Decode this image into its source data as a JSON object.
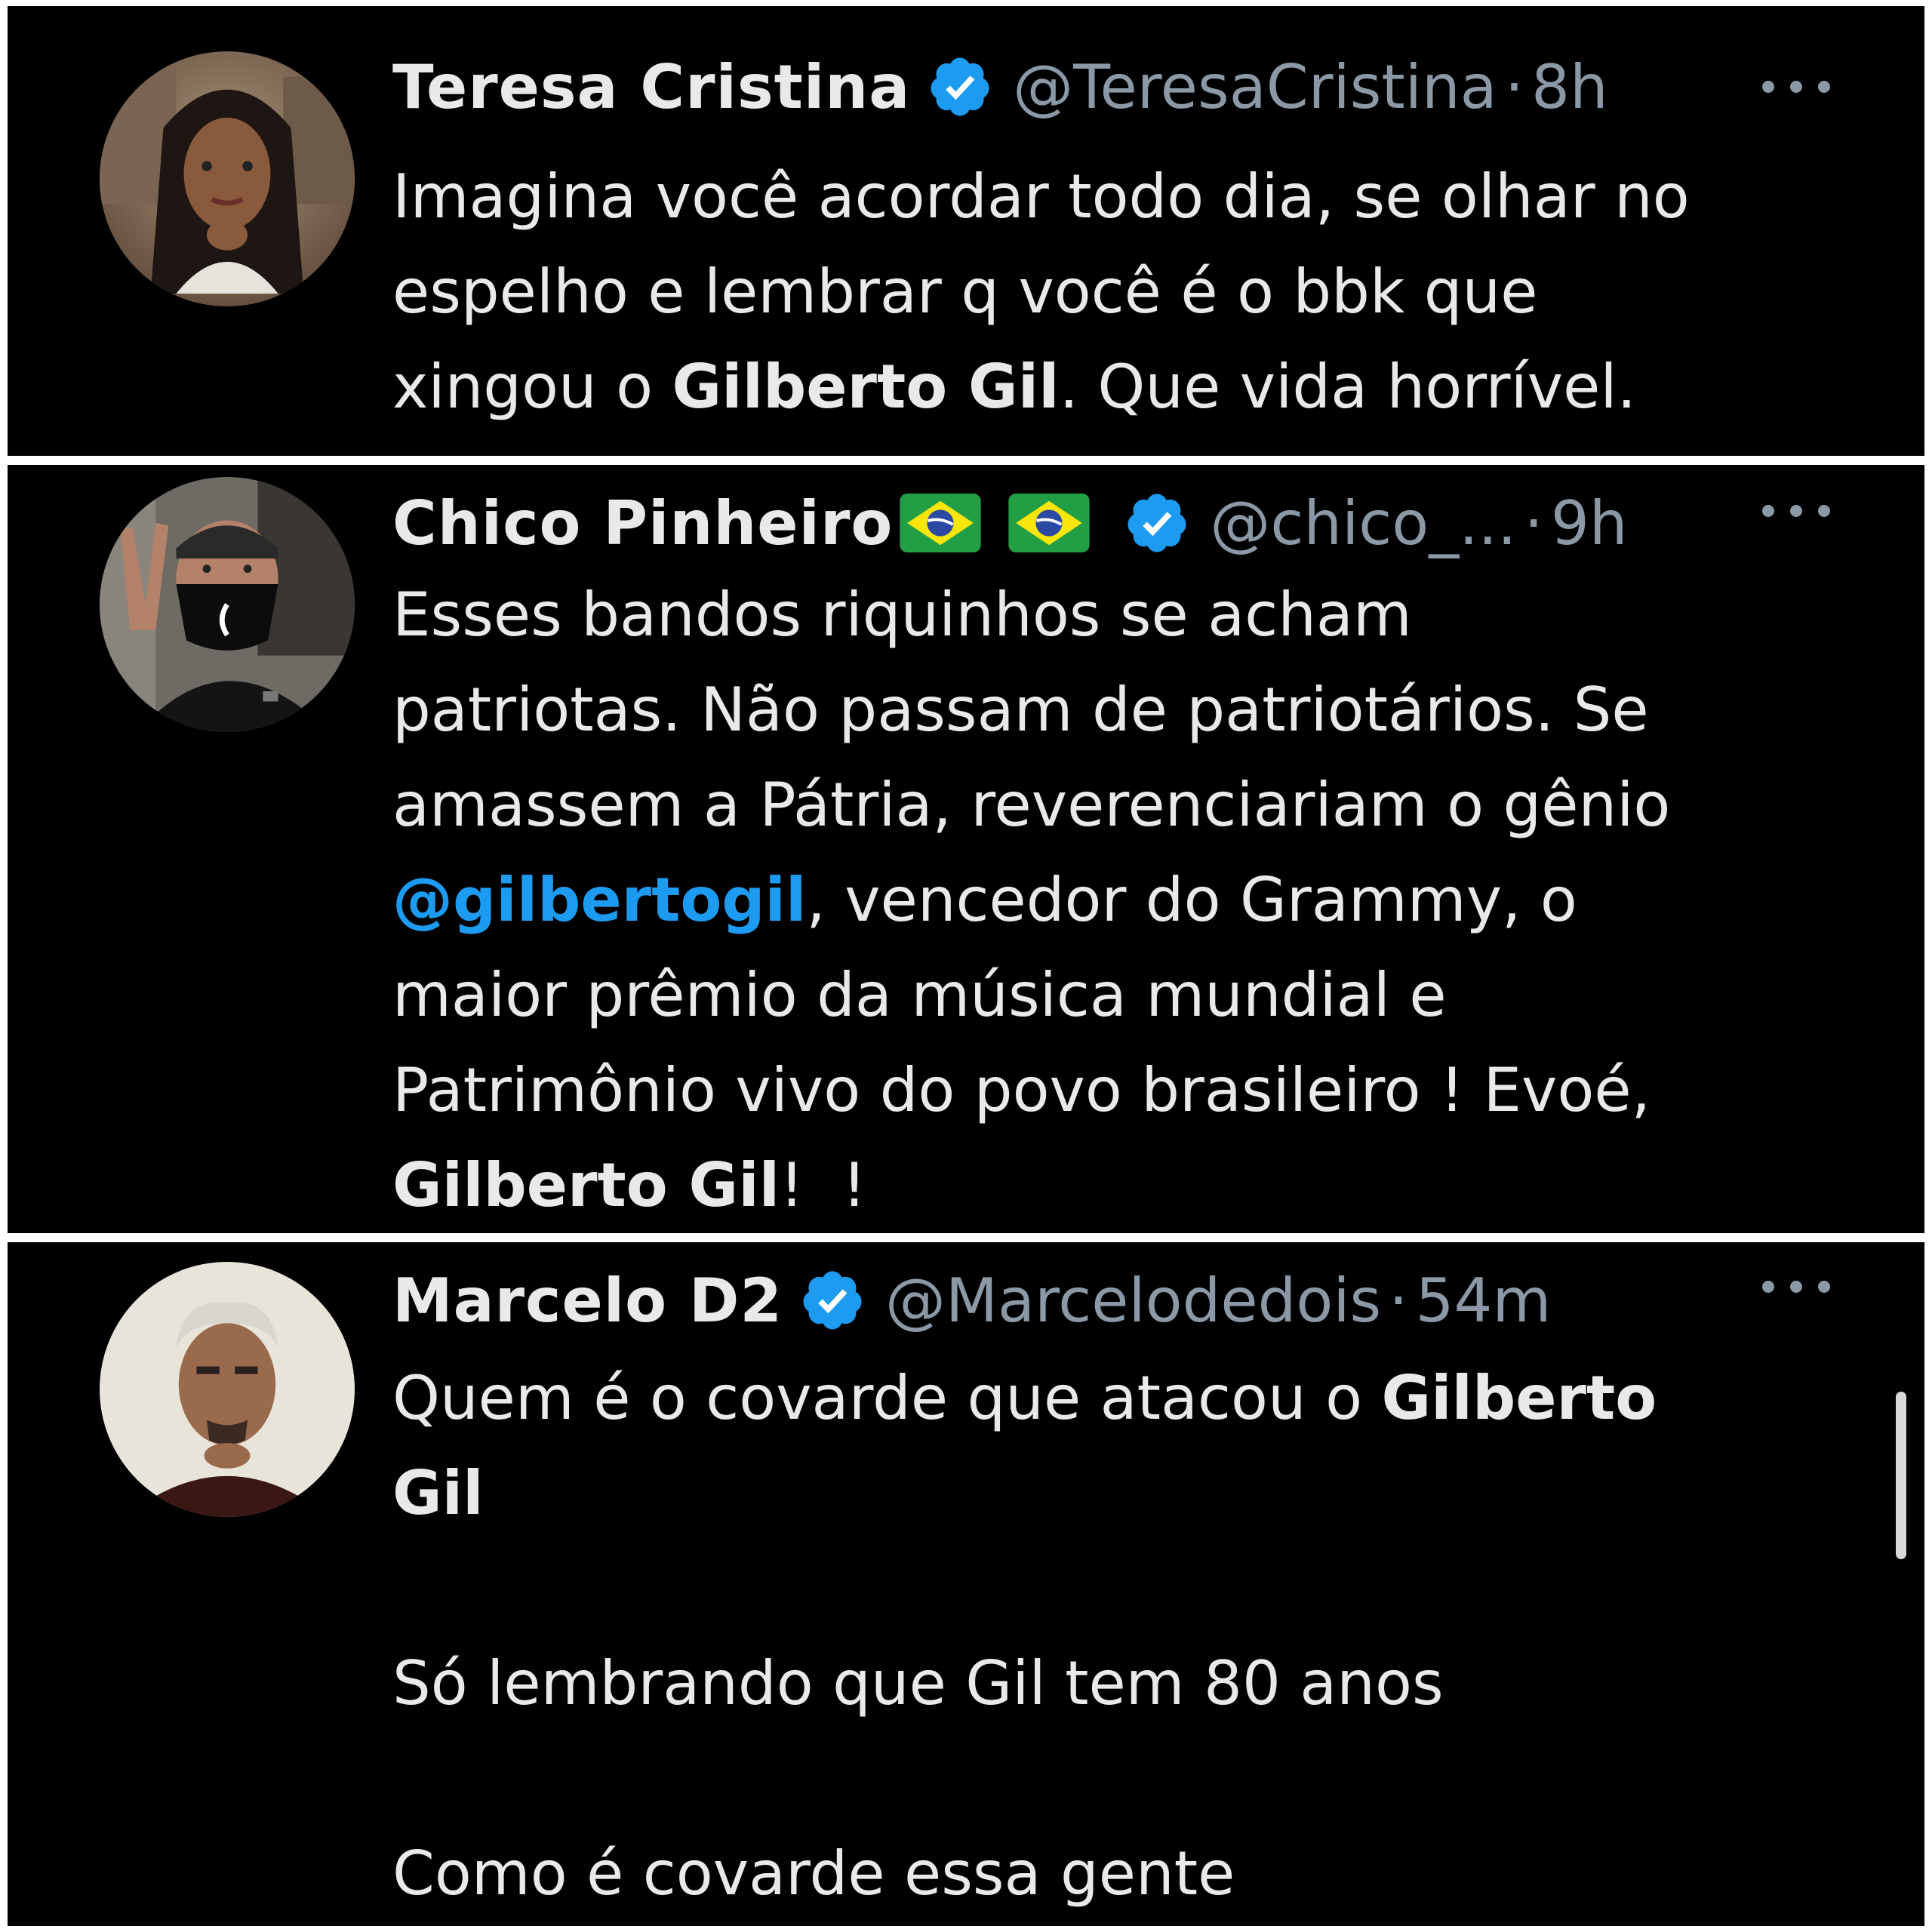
{
  "colors": {
    "background": "#000000",
    "text": "#e7e9ea",
    "muted": "#8b98a5",
    "link": "#1d9bf0",
    "verified": "#1d9bf0"
  },
  "tweets": [
    {
      "display_name": "Teresa Cristina",
      "handle": "@TeresaCristina",
      "separator": "·",
      "time": "8h",
      "verified": true,
      "avatar_icon": "avatar-photo",
      "body": {
        "line1": "Imagina você acordar todo dia, se olhar no",
        "line2": "espelho e lembrar q você é o bbk que",
        "line3_a": "xingou o ",
        "line3_b": "Gilberto Gil",
        "line3_c": ". Que vida horrível."
      }
    },
    {
      "display_name": "Chico Pinheiro",
      "flags": [
        "brazil-flag-icon",
        "brazil-flag-icon"
      ],
      "handle": "@chico_...",
      "separator": "·",
      "time": "9h",
      "verified": true,
      "avatar_icon": "avatar-photo",
      "body": {
        "line1": "Esses bandos riquinhos se acham",
        "line2": "patriotas. Não passam de patriotários. Se",
        "line3": "amassem a Pátria, reverenciariam o gênio",
        "line4_mention": "@gilbertogil",
        "line4_rest": ", vencedor do Grammy, o",
        "line5": "maior prêmio da música mundial e",
        "line6": "Patrimônio vivo do povo brasileiro ! Evoé,",
        "line7_bold": "Gilberto Gil",
        "line7_rest": "!  !"
      }
    },
    {
      "display_name": "Marcelo D2",
      "handle": "@Marcelodedois",
      "separator": "·",
      "time": "54m",
      "verified": true,
      "avatar_icon": "avatar-photo",
      "body": {
        "line1_a": "Quem é o covarde que atacou o ",
        "line1_b": "Gilberto",
        "line2_b": "Gil",
        "para2": "Só lembrando que Gil tem 80 anos",
        "para3": "Como é covarde essa gente"
      }
    }
  ]
}
